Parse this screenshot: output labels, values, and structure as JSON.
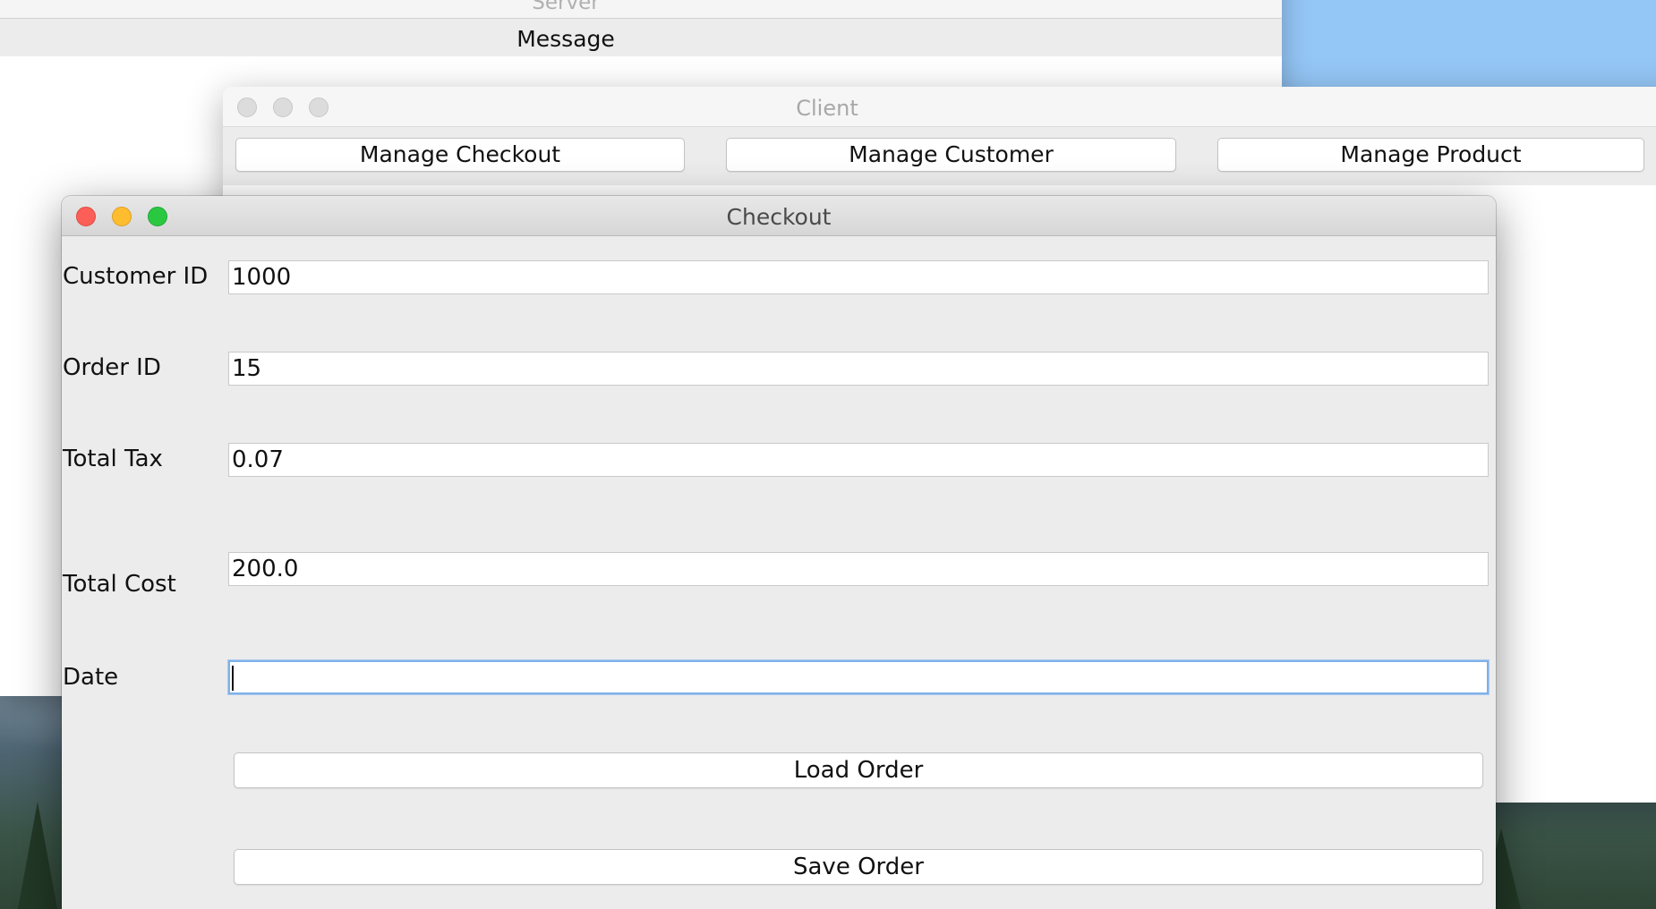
{
  "server_window": {
    "title": "Server",
    "message_label": "Message"
  },
  "client_window": {
    "title": "Client",
    "buttons": {
      "manage_checkout": "Manage Checkout",
      "manage_customer": "Manage Customer",
      "manage_product": "Manage Product"
    }
  },
  "checkout_window": {
    "title": "Checkout",
    "fields": {
      "customer_id": {
        "label": "Customer ID",
        "value": "1000"
      },
      "order_id": {
        "label": "Order ID",
        "value": "15"
      },
      "total_tax": {
        "label": "Total Tax",
        "value": "0.07"
      },
      "total_cost": {
        "label": "Total Cost",
        "value": "200.0"
      },
      "date": {
        "label": "Date",
        "value": ""
      }
    },
    "buttons": {
      "load_order": "Load Order",
      "save_order": "Save Order"
    }
  },
  "colors": {
    "close": "#fc5f57",
    "minimize": "#fdbd2e",
    "zoom": "#29c840",
    "focus_ring": "#7fb0e8",
    "desktop_sky": "#94c6f6"
  }
}
